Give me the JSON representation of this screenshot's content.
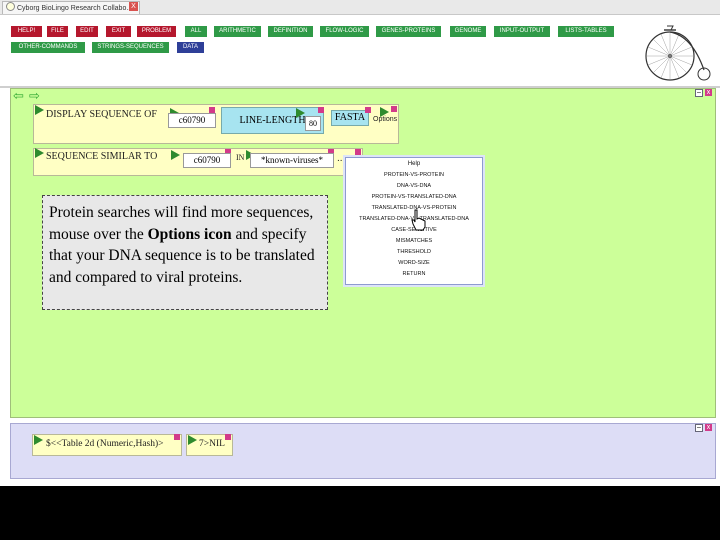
{
  "browser": {
    "tab_title": "Cyborg BioLingo Research Collabo...",
    "tab_close_label": "X"
  },
  "menu": {
    "row1": [
      {
        "label": "HELP!",
        "color": "red"
      },
      {
        "label": "FILE",
        "color": "red"
      },
      {
        "label": "EDIT",
        "color": "red"
      },
      {
        "label": "EXIT",
        "color": "red"
      },
      {
        "label": "PROBLEM",
        "color": "red"
      },
      {
        "label": "ALL",
        "color": "green"
      },
      {
        "label": "ARITHMETIC",
        "color": "green"
      },
      {
        "label": "DEFINITION",
        "color": "green"
      },
      {
        "label": "FLOW-LOGIC",
        "color": "green"
      },
      {
        "label": "GENES-PROTEINS",
        "color": "green"
      },
      {
        "label": "GENOME",
        "color": "green"
      },
      {
        "label": "INPUT-OUTPUT",
        "color": "green"
      },
      {
        "label": "LISTS-TABLES",
        "color": "green"
      }
    ],
    "row2": [
      {
        "label": "OTHER-COMMANDS",
        "color": "green"
      },
      {
        "label": "STRINGS-SEQUENCES",
        "color": "green"
      },
      {
        "label": "DATA",
        "color": "blue"
      }
    ]
  },
  "workspace": {
    "display_box": {
      "label": "DISPLAY SEQUENCE OF",
      "arg1": "c60790",
      "line_length_label": "LINE-LENGTH",
      "line_length_value": "80",
      "fasta_label": "FASTA",
      "options_label": "Options"
    },
    "similar_box": {
      "label": "SEQUENCE SIMILAR TO",
      "arg1": "c60790",
      "in_label": "IN",
      "arg2": "*known-viruses*",
      "ellipsis": "..."
    }
  },
  "options_menu": {
    "items": [
      "Help",
      "PROTEIN-VS-PROTEIN",
      "DNA-VS-DNA",
      "PROTEIN-VS-TRANSLATED-DNA",
      "TRANSLATED-DNA-VS-PROTEIN",
      "TRANSLATED-DNA-VS-TRANSLATED-DNA",
      "CASE-SENSITIVE",
      "MISMATCHES",
      "THRESHOLD",
      "WORD-SIZE",
      "RETURN"
    ]
  },
  "note": {
    "part1": "Protein searches will find more sequences, mouse over the ",
    "bold1": "Options",
    "part2": " ",
    "bold2": "icon",
    "part3": " and specify that your DNA sequence is to be translated and compared to viral proteins."
  },
  "results": [
    {
      "prefix": "$<<",
      "label": "Table 2d (Numeric,Hash)>"
    },
    {
      "prefix": "7>",
      "label": "NIL"
    }
  ],
  "colors": {
    "workspace_bg": "#ccff99",
    "results_bg": "#ddddf6",
    "menu_red": "#b5172d",
    "menu_green": "#2f9a47",
    "menu_blue": "#2e3f98"
  }
}
